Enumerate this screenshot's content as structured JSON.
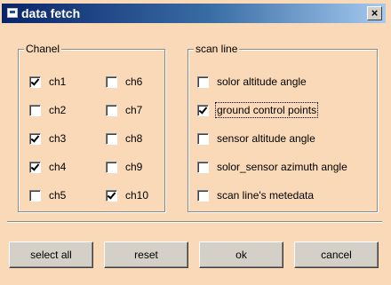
{
  "window": {
    "title": "data fetch",
    "close_label": "×"
  },
  "chanel_group": {
    "label": "Chanel",
    "items": [
      {
        "label": "ch1",
        "checked": true
      },
      {
        "label": "ch2",
        "checked": false
      },
      {
        "label": "ch3",
        "checked": true
      },
      {
        "label": "ch4",
        "checked": true
      },
      {
        "label": "ch5",
        "checked": false
      },
      {
        "label": "ch6",
        "checked": false
      },
      {
        "label": "ch7",
        "checked": false
      },
      {
        "label": "ch8",
        "checked": false
      },
      {
        "label": "ch9",
        "checked": false
      },
      {
        "label": "ch10",
        "checked": true
      }
    ]
  },
  "scan_group": {
    "label": "scan line",
    "items": [
      {
        "label": "solor altitude angle",
        "checked": false
      },
      {
        "label": "ground control points",
        "checked": true
      },
      {
        "label": "sensor altitude angle",
        "checked": false
      },
      {
        "label": "solor_sensor azimuth angle",
        "checked": false
      },
      {
        "label": "scan line's metedata",
        "checked": false
      }
    ]
  },
  "buttons": {
    "select_all": "select all",
    "reset": "reset",
    "ok": "ok",
    "cancel": "cancel"
  },
  "colors": {
    "dialog_bg": "#f9d9b8",
    "title_bar": "#0a246a"
  }
}
